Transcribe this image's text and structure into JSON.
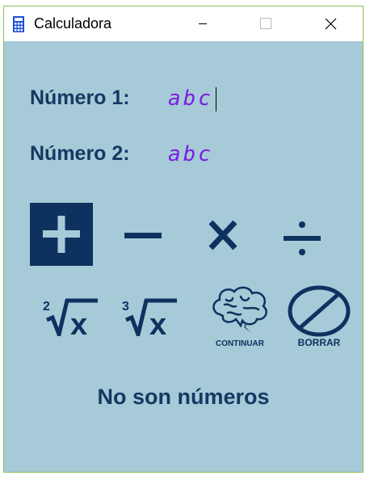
{
  "window": {
    "title": "Calculadora",
    "background": "#a6cad7",
    "accent": "#0e3260"
  },
  "form": {
    "number1_label": "Número 1:",
    "number1_value": "abc",
    "number2_label": "Número 2:",
    "number2_value": "abc"
  },
  "operations": {
    "add": {
      "icon": "plus-icon",
      "selected": true
    },
    "subtract": {
      "icon": "minus-icon"
    },
    "multiply": {
      "icon": "times-icon"
    },
    "divide": {
      "icon": "divide-icon"
    },
    "square_root": {
      "icon": "square-root-icon",
      "index": "2",
      "radicand": "x"
    },
    "cube_root": {
      "icon": "cube-root-icon",
      "index": "3",
      "radicand": "x"
    },
    "continue": {
      "icon": "brain-icon",
      "label": "CONTINUAR"
    },
    "clear": {
      "icon": "no-sign-icon",
      "label": "BORRAR"
    }
  },
  "result": {
    "text": "No son números"
  }
}
